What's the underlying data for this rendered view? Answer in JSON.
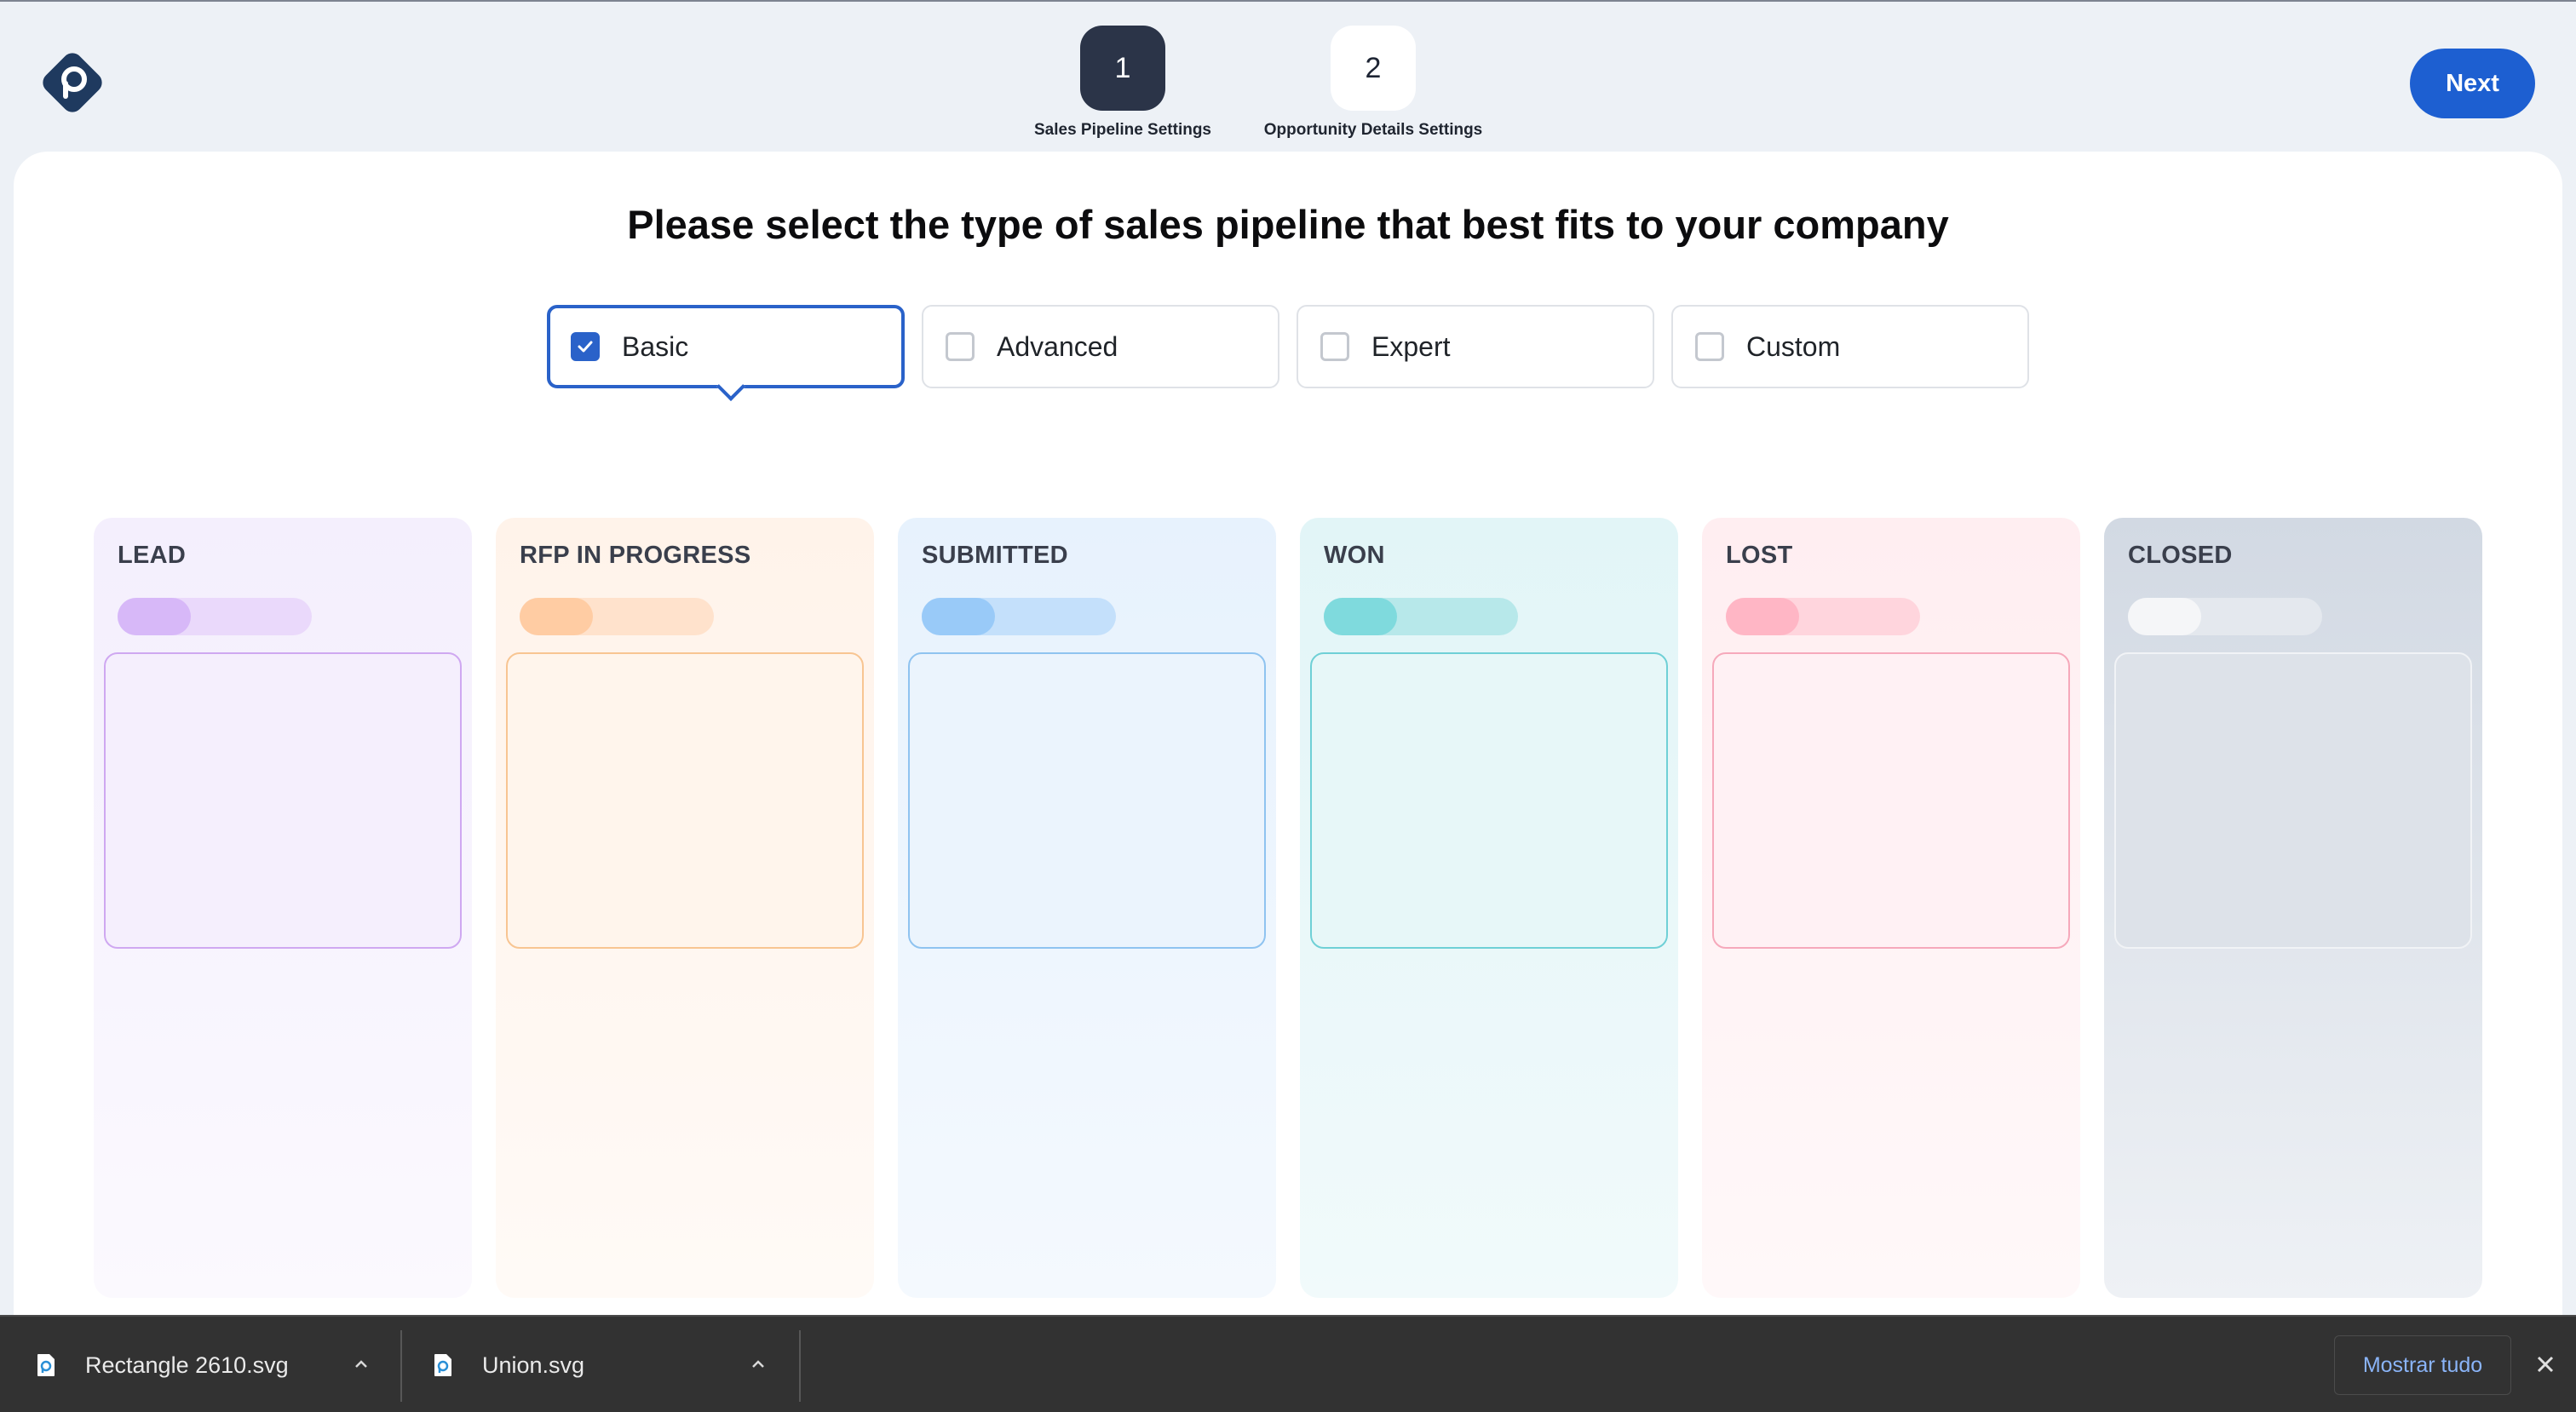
{
  "header": {
    "logo_icon": "pipeline-logo-icon",
    "steps": [
      {
        "number": "1",
        "label": "Sales Pipeline Settings",
        "state": "active"
      },
      {
        "number": "2",
        "label": "Opportunity Details Settings",
        "state": "inactive"
      }
    ],
    "next_label": "Next"
  },
  "main": {
    "heading": "Please select the type of sales pipeline that best fits to your company",
    "options": [
      {
        "label": "Basic",
        "checked": true
      },
      {
        "label": "Advanced",
        "checked": false
      },
      {
        "label": "Expert",
        "checked": false
      },
      {
        "label": "Custom",
        "checked": false
      }
    ],
    "columns": [
      {
        "title": "LEAD",
        "accent": "#d7b8f8"
      },
      {
        "title": "RFP IN PROGRESS",
        "accent": "#ffcca3"
      },
      {
        "title": "SUBMITTED",
        "accent": "#99caf8"
      },
      {
        "title": "WON",
        "accent": "#7fdadd"
      },
      {
        "title": "LOST",
        "accent": "#ffb6c5"
      },
      {
        "title": "CLOSED",
        "accent": "#d2d9e3"
      }
    ]
  },
  "downloads": {
    "items": [
      {
        "name": "Rectangle 2610.svg",
        "icon": "svg-file-icon"
      },
      {
        "name": "Union.svg",
        "icon": "svg-file-icon"
      }
    ],
    "show_all_label": "Mostrar tudo"
  },
  "colors": {
    "primary": "#1d5fd1",
    "step_active": "#2b3448",
    "selected_border": "#2a62c9"
  }
}
